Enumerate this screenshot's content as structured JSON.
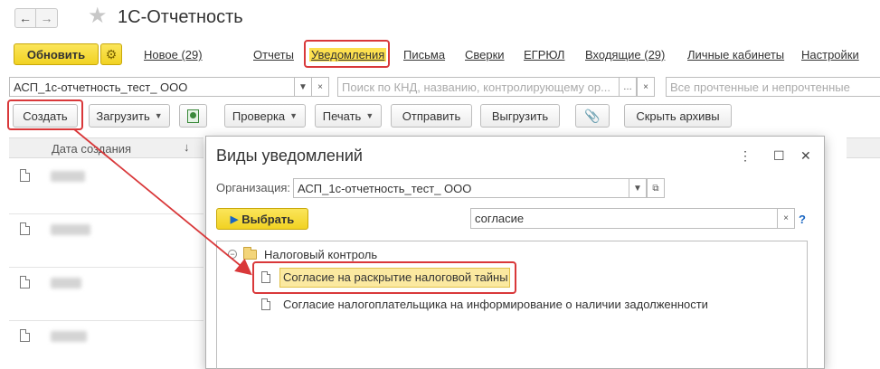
{
  "window": {
    "back_icon": "arrow-left-icon",
    "forward_icon": "arrow-right-icon",
    "favorite_icon": "star-icon",
    "title": "1С-Отчетность"
  },
  "toolbar": {
    "refresh_label": "Обновить",
    "settings_icon": "gear-icon",
    "links": [
      "Новое (29)",
      "Отчеты",
      "Уведомления",
      "Письма",
      "Сверки",
      "ЕГРЮЛ",
      "Входящие (29)",
      "Личные кабинеты",
      "Настройки"
    ],
    "active_link": "Уведомления"
  },
  "filters": {
    "organization_value": "АСП_1с-отчетность_тест_ ООО",
    "search_placeholder": "Поиск по КНД, названию, контролирующему ор...",
    "status_placeholder": "Все прочтенные и непрочтенные"
  },
  "actions": {
    "create_label": "Создать",
    "load_label": "Загрузить",
    "check_label": "Проверка",
    "print_label": "Печать",
    "send_label": "Отправить",
    "export_label": "Выгрузить",
    "hide_archives_label": "Скрыть архивы"
  },
  "table": {
    "column_header": "Дата создания",
    "sort_indicator": "↓",
    "row_count": 4
  },
  "dialog": {
    "title": "Виды уведомлений",
    "org_label": "Организация:",
    "org_value": "АСП_1с-отчетность_тест_ ООО",
    "select_label": "Выбрать",
    "search_value": "согласие",
    "help_label": "?",
    "tree": {
      "group": "Налоговый контроль",
      "items": [
        "Согласие на раскрытие налоговой тайны",
        "Согласие налогоплательщика на информирование о наличии задолженности"
      ],
      "selected_index": 0
    }
  },
  "colors": {
    "accent_yellow": "#f1d222",
    "highlight_red": "#d9383a",
    "selection_fill": "#fbe9a0"
  }
}
